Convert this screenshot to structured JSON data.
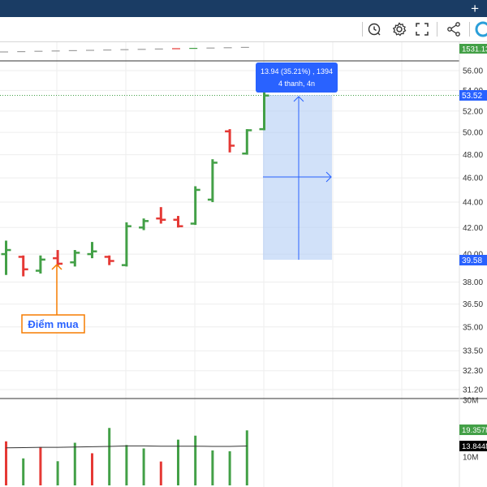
{
  "toolbar": {
    "icons": [
      "alert-clock-icon",
      "gear-icon",
      "fullscreen-icon",
      "share-icon"
    ],
    "add_label": "+"
  },
  "colors": {
    "up": "#43a047",
    "down": "#e53935",
    "measure_fill": "#b3cdf5",
    "measure_line": "#2962ff",
    "annotation": "#f57c00",
    "annotation_text": "#2962ff",
    "dark_tag": "#000000",
    "blue_tag": "#2962ff",
    "green_tag": "#43a047"
  },
  "measure_box": {
    "line1": "13.94 (35.21%) , 1394",
    "line2": "4 thanh, 4n"
  },
  "annotation": {
    "label": "Điểm mua"
  },
  "tags": {
    "top_value": "1531.13",
    "current_price": "53.52",
    "entry_price": "39.58",
    "volume_value": "19.357M",
    "volume_ma": "13.844M"
  },
  "chart_data": {
    "type": "ohlc",
    "price_axis": {
      "ticks": [
        "56.00",
        "54.00",
        "52.00",
        "50.00",
        "48.00",
        "46.00",
        "44.00",
        "42.00",
        "40.00",
        "38.00",
        "36.50",
        "35.00",
        "33.50",
        "32.30",
        "31.20"
      ],
      "scale": "log"
    },
    "volume_axis": {
      "ticks": [
        "30M",
        "10M"
      ]
    },
    "bars": [
      {
        "open": 40.0,
        "high": 41.0,
        "low": 38.5,
        "close": 40.3
      },
      {
        "open": 39.8,
        "high": 39.9,
        "low": 38.4,
        "close": 38.9
      },
      {
        "open": 38.8,
        "high": 39.9,
        "low": 38.6,
        "close": 39.6
      },
      {
        "open": 39.7,
        "high": 40.3,
        "low": 39.1,
        "close": 39.3
      },
      {
        "open": 39.4,
        "high": 40.3,
        "low": 39.1,
        "close": 40.1
      },
      {
        "open": 40.0,
        "high": 40.9,
        "low": 39.7,
        "close": 40.2
      },
      {
        "open": 39.8,
        "high": 39.9,
        "low": 39.2,
        "close": 39.5
      },
      {
        "open": 39.2,
        "high": 42.4,
        "low": 39.1,
        "close": 42.1
      },
      {
        "open": 42.0,
        "high": 42.7,
        "low": 41.8,
        "close": 42.5
      },
      {
        "open": 42.7,
        "high": 43.6,
        "low": 42.3,
        "close": 42.6
      },
      {
        "open": 42.6,
        "high": 42.9,
        "low": 42.0,
        "close": 42.1
      },
      {
        "open": 42.3,
        "high": 45.3,
        "low": 42.2,
        "close": 45.0
      },
      {
        "open": 44.2,
        "high": 47.6,
        "low": 44.0,
        "close": 47.3
      },
      {
        "open": 50.1,
        "high": 50.3,
        "low": 48.2,
        "close": 48.8
      },
      {
        "open": 48.1,
        "high": 50.3,
        "low": 48.0,
        "close": 50.2
      },
      {
        "open": 50.3,
        "high": 53.8,
        "low": 50.2,
        "close": 53.5
      }
    ],
    "volume": [
      {
        "value": 15.5,
        "dir": "down"
      },
      {
        "value": 9.5,
        "dir": "up"
      },
      {
        "value": 13.5,
        "dir": "down"
      },
      {
        "value": 8.5,
        "dir": "up"
      },
      {
        "value": 15.0,
        "dir": "up"
      },
      {
        "value": 11.3,
        "dir": "down"
      },
      {
        "value": 20.2,
        "dir": "up"
      },
      {
        "value": 14.2,
        "dir": "up"
      },
      {
        "value": 13.0,
        "dir": "up"
      },
      {
        "value": 8.4,
        "dir": "down"
      },
      {
        "value": 16.1,
        "dir": "up"
      },
      {
        "value": 17.5,
        "dir": "up"
      },
      {
        "value": 12.3,
        "dir": "up"
      },
      {
        "value": 12.0,
        "dir": "up"
      },
      {
        "value": 19.357,
        "dir": "up"
      }
    ],
    "volume_ma": [
      13.2,
      13.3,
      13.4,
      13.4,
      13.5,
      13.6,
      13.7,
      13.9,
      13.9,
      13.8,
      13.8,
      13.8,
      13.7,
      13.7,
      13.844
    ]
  }
}
